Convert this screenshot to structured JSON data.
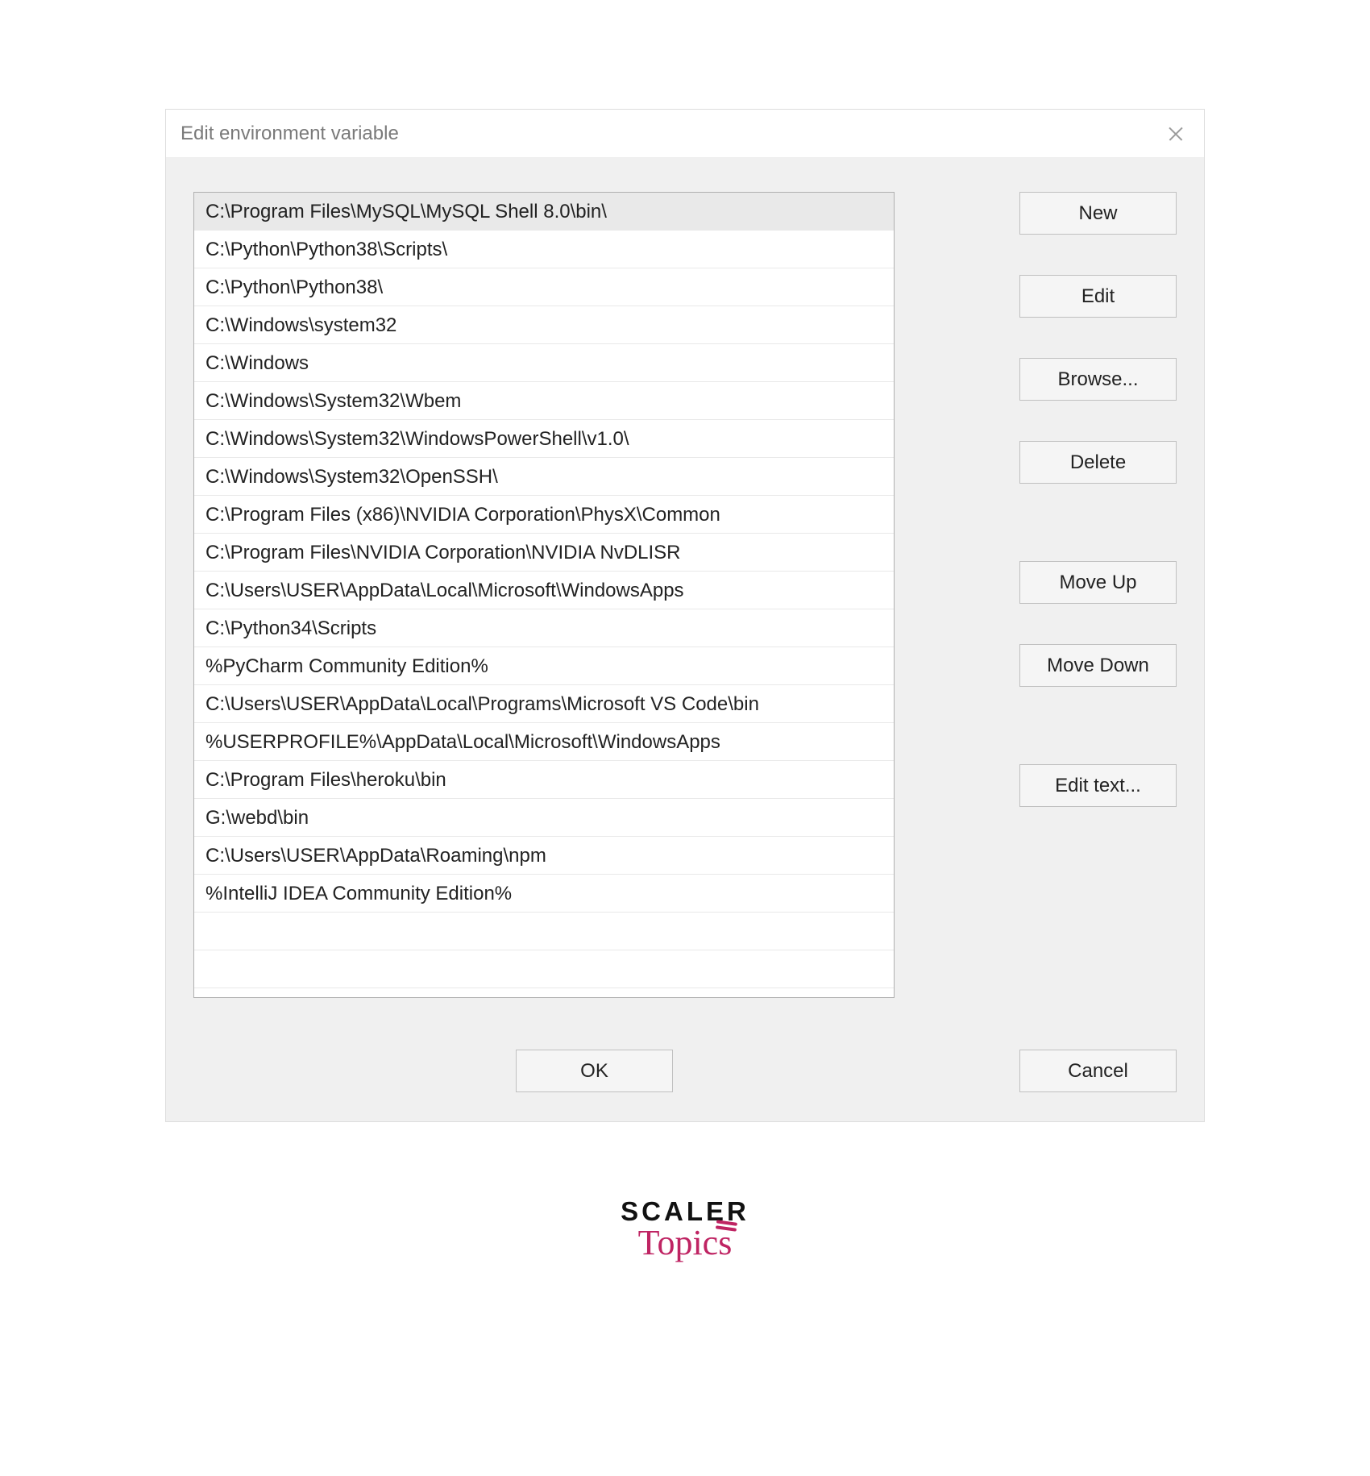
{
  "dialog": {
    "title": "Edit environment variable",
    "buttons": {
      "new": "New",
      "edit": "Edit",
      "browse": "Browse...",
      "delete": "Delete",
      "move_up": "Move Up",
      "move_down": "Move Down",
      "edit_text": "Edit text...",
      "ok": "OK",
      "cancel": "Cancel"
    },
    "selected_index": 0,
    "paths": [
      "C:\\Program Files\\MySQL\\MySQL Shell 8.0\\bin\\",
      "C:\\Python\\Python38\\Scripts\\",
      "C:\\Python\\Python38\\",
      "C:\\Windows\\system32",
      "C:\\Windows",
      "C:\\Windows\\System32\\Wbem",
      "C:\\Windows\\System32\\WindowsPowerShell\\v1.0\\",
      "C:\\Windows\\System32\\OpenSSH\\",
      "C:\\Program Files (x86)\\NVIDIA Corporation\\PhysX\\Common",
      "C:\\Program Files\\NVIDIA Corporation\\NVIDIA NvDLISR",
      "C:\\Users\\USER\\AppData\\Local\\Microsoft\\WindowsApps",
      "C:\\Python34\\Scripts",
      "%PyCharm Community Edition%",
      "C:\\Users\\USER\\AppData\\Local\\Programs\\Microsoft VS Code\\bin",
      "%USERPROFILE%\\AppData\\Local\\Microsoft\\WindowsApps",
      "C:\\Program Files\\heroku\\bin",
      "G:\\webd\\bin",
      "C:\\Users\\USER\\AppData\\Roaming\\npm",
      "%IntelliJ IDEA Community Edition%"
    ]
  },
  "branding": {
    "line1": "SCALER",
    "line2": "Topics"
  }
}
